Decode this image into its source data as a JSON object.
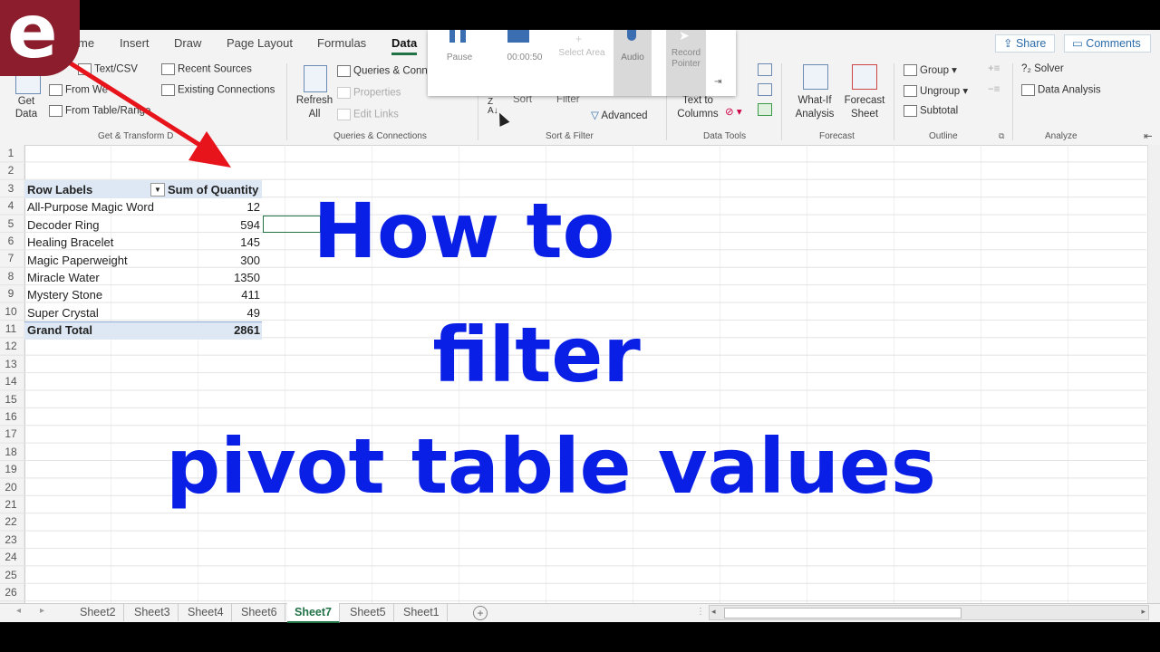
{
  "ribbon_tabs": [
    "me",
    "Insert",
    "Draw",
    "Page Layout",
    "Formulas",
    "Data"
  ],
  "header_buttons": {
    "share": "Share",
    "comments": "Comments"
  },
  "recorder": {
    "pause": "Pause",
    "time": "00:00:50",
    "select_area": "Select Area",
    "audio": "Audio",
    "record_pointer": "Record Pointer"
  },
  "get_transform": {
    "get_data": "Get Data",
    "text_csv": "Text/CSV",
    "from_web": "From We",
    "from_table": "From Table/Range",
    "recent_sources": "Recent Sources",
    "existing_connections": "Existing Connections",
    "group_label": "Get & Transform D"
  },
  "queries": {
    "refresh_all": "Refresh All",
    "queries_connections": "Queries & Conn",
    "properties": "Properties",
    "edit_links": "Edit Links",
    "group_label": "Queries & Connections"
  },
  "sort_filter": {
    "sort": "Sort",
    "filter": "Filter",
    "advanced": "Advanced",
    "group_label": "Sort & Filter"
  },
  "data_tools": {
    "text_to_columns": "Text to Columns",
    "group_label": "Data Tools"
  },
  "forecast": {
    "what_if": "What-If Analysis",
    "forecast_sheet": "Forecast Sheet",
    "group_label": "Forecast"
  },
  "outline": {
    "group": "Group",
    "ungroup": "Ungroup",
    "subtotal": "Subtotal",
    "group_label": "Outline"
  },
  "analyze": {
    "solver": "Solver",
    "data_analysis": "Data Analysis",
    "group_label": "Analyze"
  },
  "rows": [
    "1",
    "2",
    "3",
    "4",
    "5",
    "6",
    "7",
    "8",
    "9",
    "10",
    "11",
    "12",
    "13",
    "14",
    "15",
    "16",
    "17",
    "18",
    "19",
    "20",
    "21",
    "22",
    "23",
    "24",
    "25",
    "26"
  ],
  "pivot": {
    "header_label": "Row Labels",
    "header_value": "Sum of Quantity",
    "items": [
      {
        "label": "All-Purpose Magic Word",
        "value": "12"
      },
      {
        "label": "Decoder Ring",
        "value": "594"
      },
      {
        "label": "Healing Bracelet",
        "value": "145"
      },
      {
        "label": "Magic Paperweight",
        "value": "300"
      },
      {
        "label": "Miracle Water",
        "value": "1350"
      },
      {
        "label": "Mystery Stone",
        "value": "411"
      },
      {
        "label": "Super Crystal",
        "value": "49"
      }
    ],
    "total_label": "Grand Total",
    "total_value": "2861"
  },
  "overlay_text": {
    "line1": "How to",
    "line2": "filter",
    "line3": "pivot table values"
  },
  "logo_letter": "e",
  "sheet_tabs": [
    "Sheet2",
    "Sheet3",
    "Sheet4",
    "Sheet6",
    "Sheet7",
    "Sheet5",
    "Sheet1"
  ],
  "active_sheet": "Sheet7",
  "colors": {
    "accent": "#217346",
    "overlay_text": "#0a1fe6",
    "arrow": "#e8141b",
    "logo": "#8b1d2c"
  }
}
